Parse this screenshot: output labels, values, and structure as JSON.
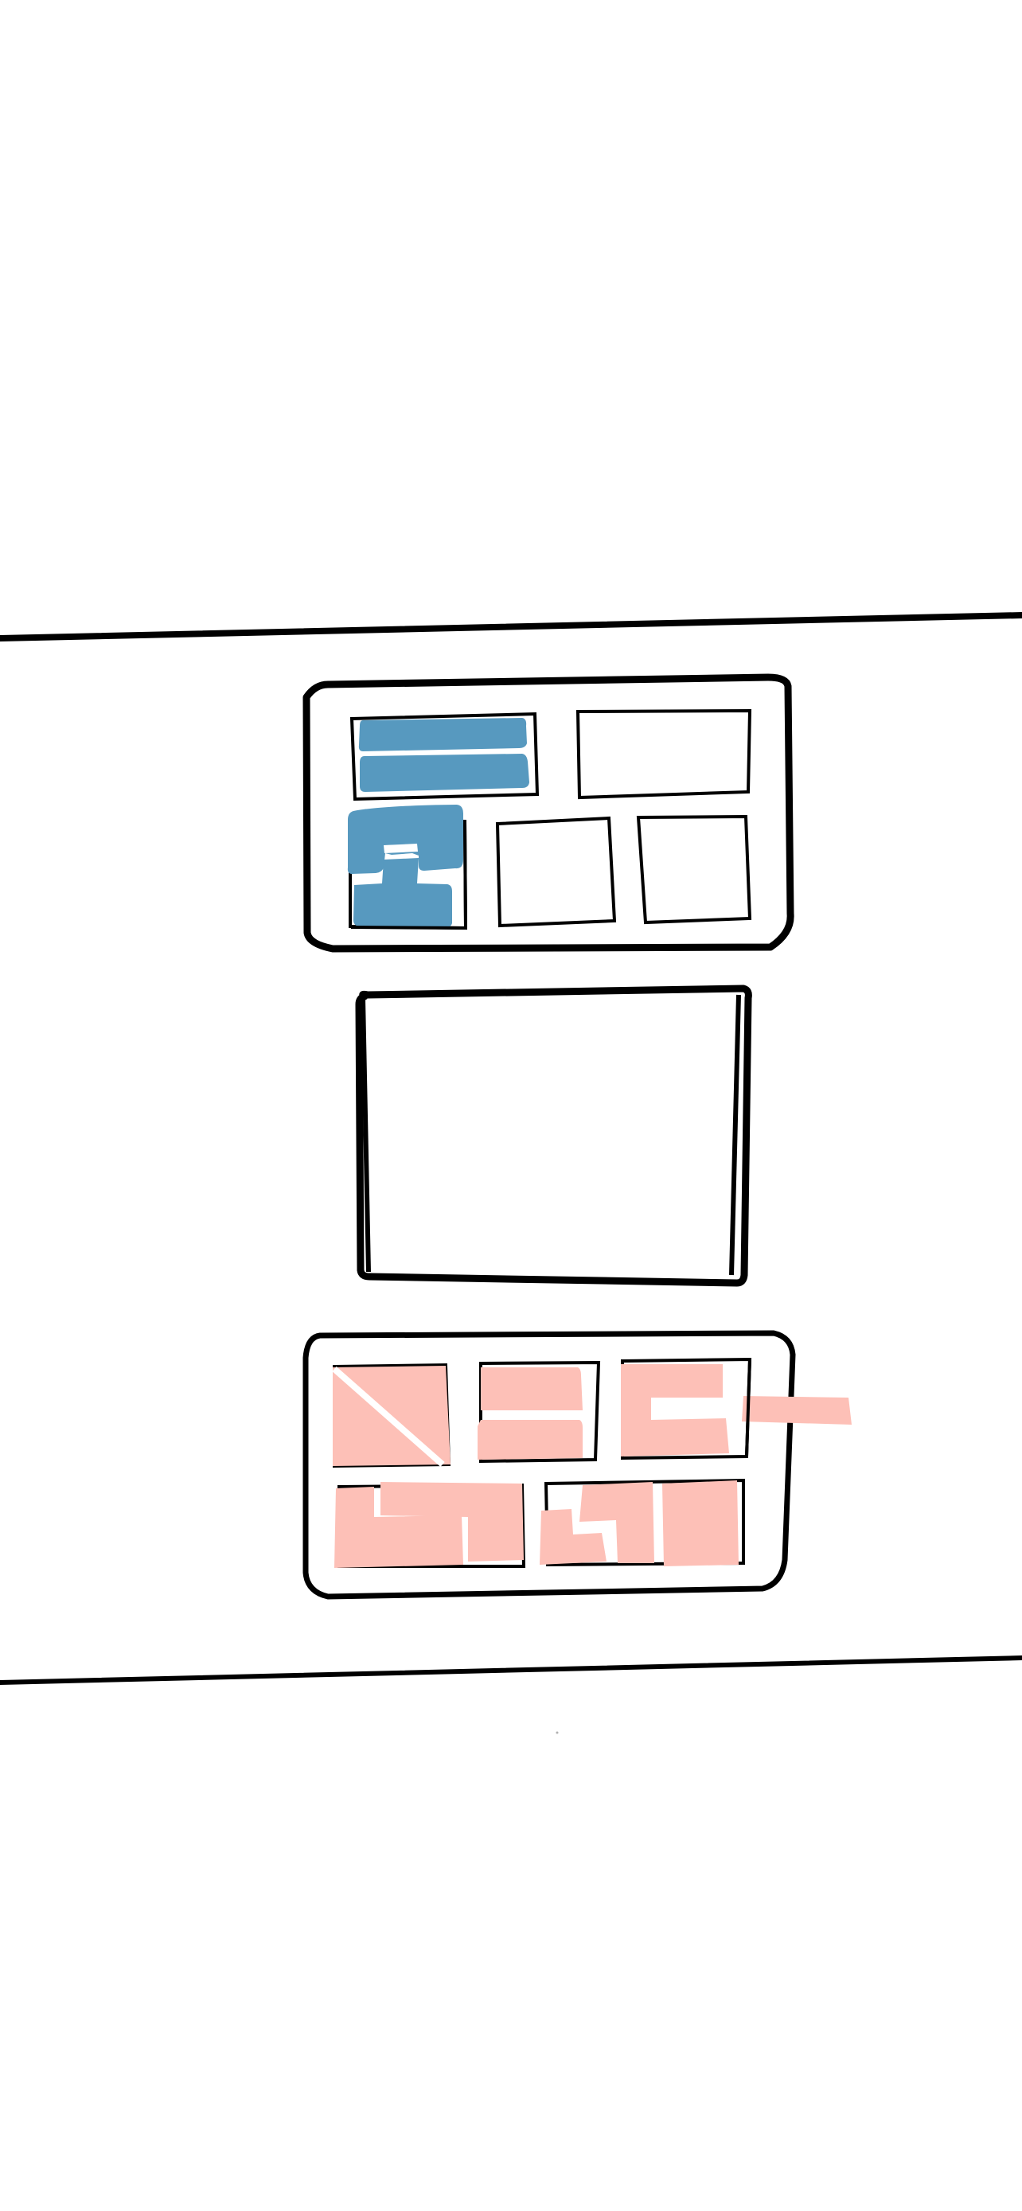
{
  "canvas": {
    "background": "#ffffff"
  },
  "colors": {
    "ink": "#000000",
    "blue_fill": "#5799bf",
    "pink_fill": "#fdc0b7",
    "paper": "#ffffff"
  },
  "sketch": {
    "frames": [
      {
        "name": "frame-blue",
        "fill_color_key": "blue_fill"
      },
      {
        "name": "frame-blank",
        "fill_color_key": "paper"
      },
      {
        "name": "frame-pink",
        "fill_color_key": "pink_fill"
      }
    ]
  }
}
